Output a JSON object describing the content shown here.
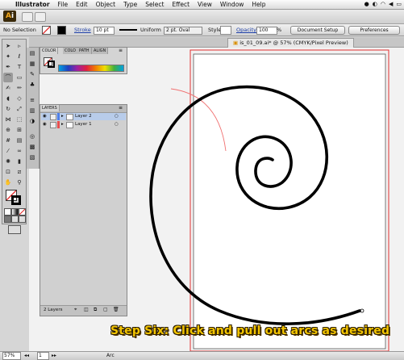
{
  "menubar": {
    "app": "Illustrator",
    "items": [
      "File",
      "Edit",
      "Object",
      "Type",
      "Select",
      "Effect",
      "View",
      "Window",
      "Help"
    ]
  },
  "control_bar": {
    "selection": "No Selection",
    "stroke_label": "Stroke",
    "stroke_value": "10 pt",
    "profile_value": "Uniform",
    "brush_value": "2 pt. Oval",
    "style_label": "Style",
    "opacity_label": "Opacity",
    "opacity_value": "100",
    "opacity_unit": "%",
    "document_setup": "Document Setup",
    "preferences": "Preferences"
  },
  "document_tab": "is_01_09.ai* @ 57% (CMYK/Pixel Preview)",
  "color_panel": {
    "tabs": [
      "COLOR",
      "COLO",
      "PATH",
      "ALIGN"
    ]
  },
  "layers_panel": {
    "title": "LAYERS",
    "layers": [
      {
        "name": "Layer 2",
        "color": "#4f7fe8",
        "selected": true
      },
      {
        "name": "Layer 1",
        "color": "#e84f4f",
        "selected": false
      }
    ],
    "footer": "2 Layers"
  },
  "status_bar": {
    "zoom": "57%",
    "page": "1",
    "tool": "Arc"
  },
  "caption": "Step Six:  Click and pull out arcs as desired",
  "colors": {
    "artboard_border": "#e03030",
    "guide_arc": "#f07070",
    "spiral": "#000000",
    "caption_fill": "#f3c400"
  }
}
